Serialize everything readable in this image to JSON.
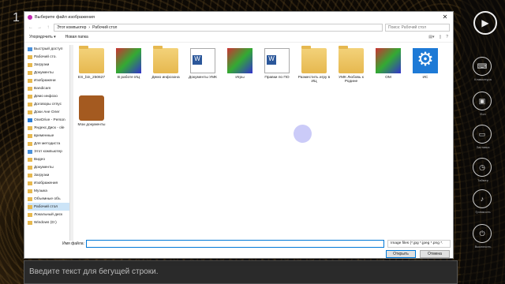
{
  "dialog": {
    "title": "Выберите файл изображения",
    "close": "✕"
  },
  "address": {
    "back": "←",
    "forward": "→",
    "up": "↑",
    "path": [
      "Этот компьютер",
      "Рабочий стол"
    ],
    "search_placeholder": "Поиск: Рабочий стол"
  },
  "toolbar": {
    "organize": "Упорядочить ▾",
    "new_folder": "Новая папка"
  },
  "sidebar": [
    "Быстрый доступ",
    "Рабочий сто.",
    "Загрузки",
    "Документы",
    "Изображени",
    "Bandicam",
    "Демо инфозо",
    "Договоры отпус",
    "Доки Ане Олег",
    "OneDrive - Person",
    "Яндекс.Диск - ole",
    "временные",
    "Для методиста",
    "Этот компьютер",
    "Видео",
    "Документы",
    "Загрузки",
    "Изображения",
    "Музыка",
    "Объемные объ",
    "Рабочий стол",
    "Локальный диск",
    "Windows (D:)"
  ],
  "files": [
    {
      "label": "ES_bin_250627",
      "kind": "folder"
    },
    {
      "label": "В работе ИЦ",
      "kind": "image"
    },
    {
      "label": "Демо инфозона",
      "kind": "folder"
    },
    {
      "label": "Документы УМК",
      "kind": "doc"
    },
    {
      "label": "Игры",
      "kind": "image"
    },
    {
      "label": "Правки по ПО",
      "kind": "doc"
    },
    {
      "label": "Разместить игру в ИЦ",
      "kind": "folder"
    },
    {
      "label": "УМК Любовь к Родине",
      "kind": "folder"
    },
    {
      "label": "ОМ",
      "kind": "image"
    },
    {
      "label": "ИС",
      "kind": "gear"
    },
    {
      "label": "Мои документы",
      "kind": "case"
    }
  ],
  "bottom": {
    "filename_label": "Имя файла:",
    "filetype": "Image files (*.jpg *.jpeg *.png *.",
    "open": "Открыть",
    "cancel": "Отмена"
  },
  "ticker": "Введите текст для бегущей строки.",
  "side_buttons": [
    "Клавиатура",
    "Фон",
    "Заставка",
    "Таймер",
    "Громкость",
    "Выключить"
  ],
  "left_num": "1"
}
